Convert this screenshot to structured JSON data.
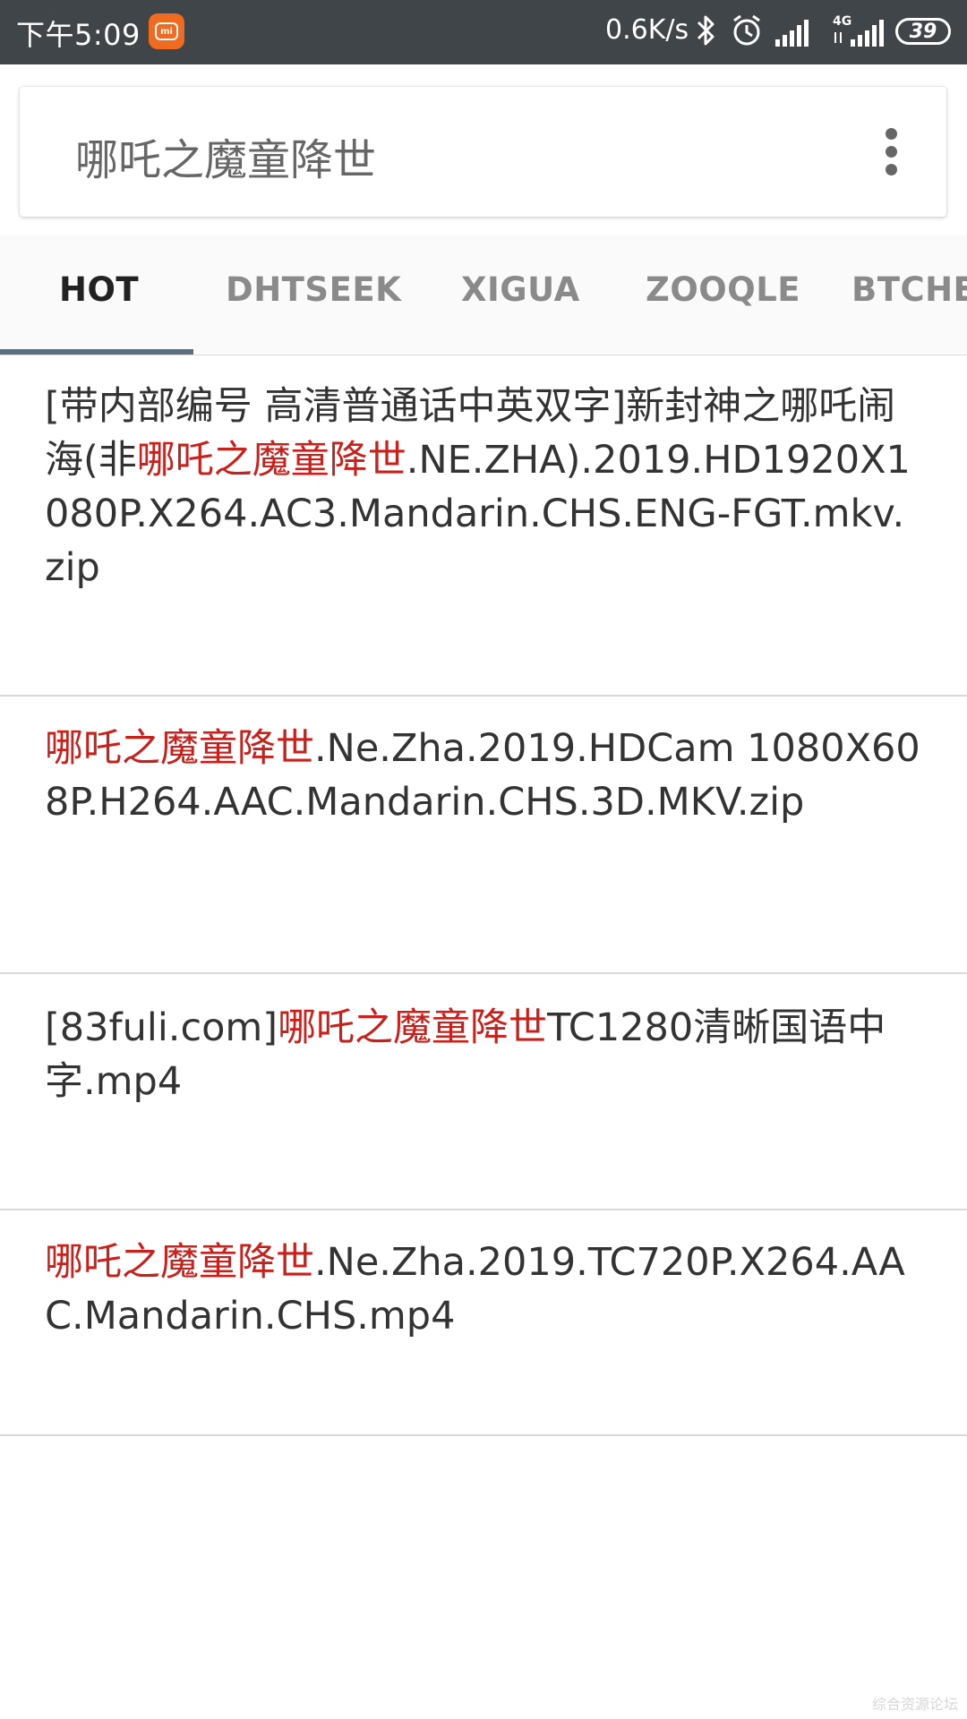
{
  "status_bar": {
    "time": "下午5:09",
    "net_speed": "0.6K/s",
    "network_type": "4G",
    "battery": "39",
    "icons": [
      "mi-app-icon",
      "bluetooth-icon",
      "alarm-icon",
      "wifi-signal-icon",
      "cell-signal-icon",
      "battery-icon"
    ]
  },
  "search": {
    "query": "哪吒之魔童降世",
    "menu_icon": "more-vertical-icon"
  },
  "tabs": [
    {
      "label": "HOT",
      "active": true
    },
    {
      "label": "DHTSEEK",
      "active": false
    },
    {
      "label": "XIGUA",
      "active": false
    },
    {
      "label": "ZOOQLE",
      "active": false
    },
    {
      "label": "BTCHE",
      "active": false
    }
  ],
  "results": [
    {
      "parts": [
        "[带内部编号 高清普通话中英双字]新封神之哪吒闹海(非",
        "哪吒之魔童降世",
        ".NE.ZHA).2019.HD1920X1080P.X264.AC3.Mandarin.CHS.ENG-FGT.mkv.zip"
      ]
    },
    {
      "parts": [
        "",
        "哪吒之魔童降世",
        ".Ne.Zha.2019.HDCam 1080X608P.H264.AAC.Mandarin.CHS.3D.MKV.zip"
      ]
    },
    {
      "parts": [
        "[83fuli.com]",
        "哪吒之魔童降世",
        "TC1280清晰国语中字.mp4"
      ]
    },
    {
      "parts": [
        "",
        "哪吒之魔童降世",
        ".Ne.Zha.2019.TC720P.X264.AAC.Mandarin.CHS.mp4"
      ]
    }
  ],
  "colors": {
    "status_bar": "#3f4549",
    "highlight": "#c8201b",
    "tab_indicator": "#5b6f7c",
    "mi_badge": "#f06a1f"
  },
  "watermark": "综合资源论坛"
}
